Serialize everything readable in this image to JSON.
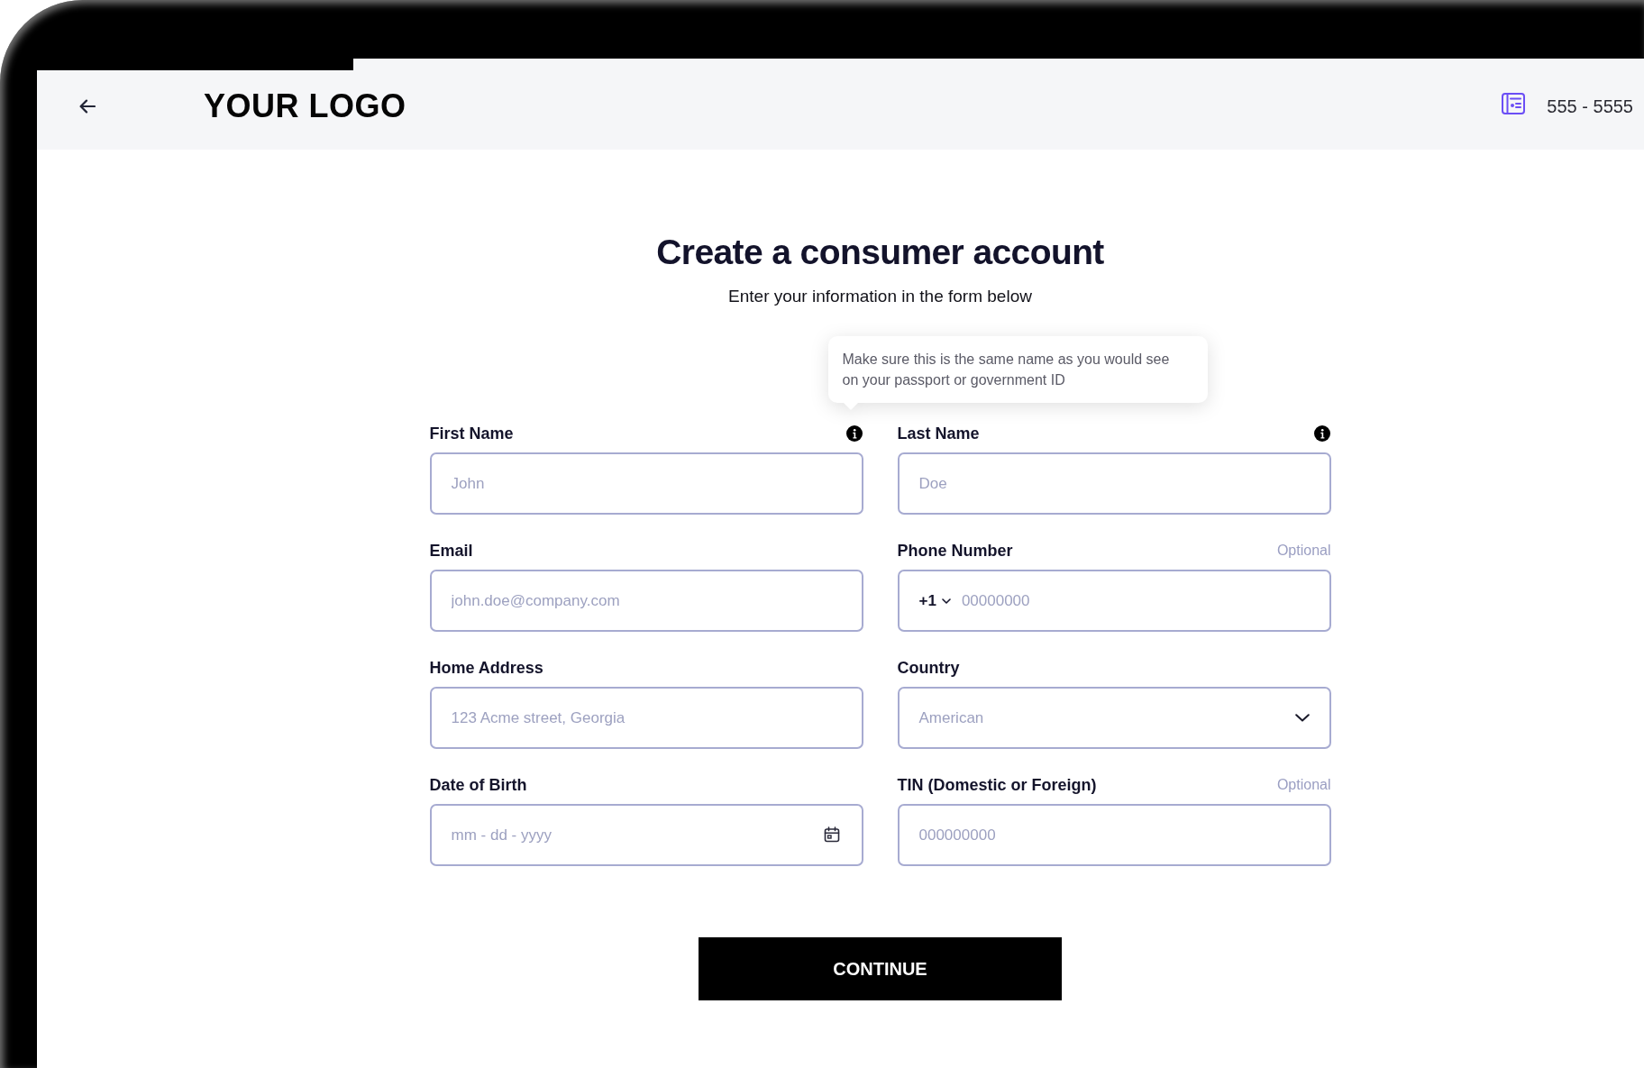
{
  "header": {
    "logo": "YOUR LOGO",
    "phone": "555 - 5555"
  },
  "title": "Create a consumer account",
  "subtitle": "Enter your information in the form below",
  "fields": [
    {
      "label": "First Name",
      "kind": "text",
      "placeholder": "John",
      "info": true,
      "tooltip": "Make sure this is the same name as you would see on your passport or government ID"
    },
    {
      "label": "Last Name",
      "kind": "text",
      "placeholder": "Doe",
      "info": true
    },
    {
      "label": "Email",
      "kind": "text",
      "placeholder": "john.doe@company.com",
      "info": false
    },
    {
      "label": "Phone Number",
      "kind": "phone",
      "optional": "Optional",
      "prefix": "+1",
      "placeholder": "00000000",
      "info": false
    },
    {
      "label": "Home Address",
      "kind": "text",
      "placeholder": "123 Acme street, Georgia",
      "info": false
    },
    {
      "label": "Country",
      "kind": "select",
      "placeholder": "American",
      "info": false
    },
    {
      "label": "Date of Birth",
      "kind": "date",
      "placeholder": "mm - dd - yyyy",
      "info": false
    },
    {
      "label": "TIN (Domestic or Foreign)",
      "kind": "text",
      "optional": "Optional",
      "placeholder": "000000000",
      "info": false
    }
  ],
  "continue_button": "CONTINUE"
}
